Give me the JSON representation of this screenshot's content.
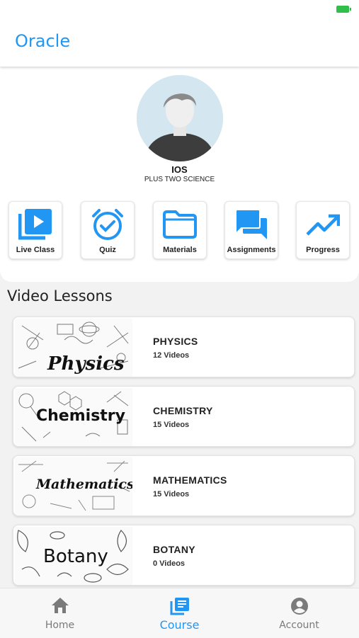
{
  "app": {
    "title": "Oracle"
  },
  "profile": {
    "name": "IOS",
    "course": "PLUS TWO SCIENCE"
  },
  "quick_actions": [
    {
      "label": "Live Class",
      "icon": "video-library-icon"
    },
    {
      "label": "Quiz",
      "icon": "alarm-check-icon"
    },
    {
      "label": "Materials",
      "icon": "folder-icon"
    },
    {
      "label": "Assignments",
      "icon": "forum-icon"
    },
    {
      "label": "Progress",
      "icon": "trending-up-icon"
    }
  ],
  "lessons_section": {
    "title": "Video Lessons"
  },
  "lessons": [
    {
      "name": "PHYSICS",
      "count": "12 Videos",
      "thumb_text": "Physics"
    },
    {
      "name": "CHEMISTRY",
      "count": "15 Videos",
      "thumb_text": "Chemistry"
    },
    {
      "name": "MATHEMATICS",
      "count": "15 Videos",
      "thumb_text": "Mathematics"
    },
    {
      "name": "BOTANY",
      "count": "0 Videos",
      "thumb_text": "Botany"
    }
  ],
  "bottom_nav": [
    {
      "label": "Home",
      "icon": "home-icon",
      "active": false
    },
    {
      "label": "Course",
      "icon": "library-books-icon",
      "active": true
    },
    {
      "label": "Account",
      "icon": "account-circle-icon",
      "active": false
    }
  ],
  "colors": {
    "accent": "#2196f3",
    "battery": "#2fbf4a"
  }
}
